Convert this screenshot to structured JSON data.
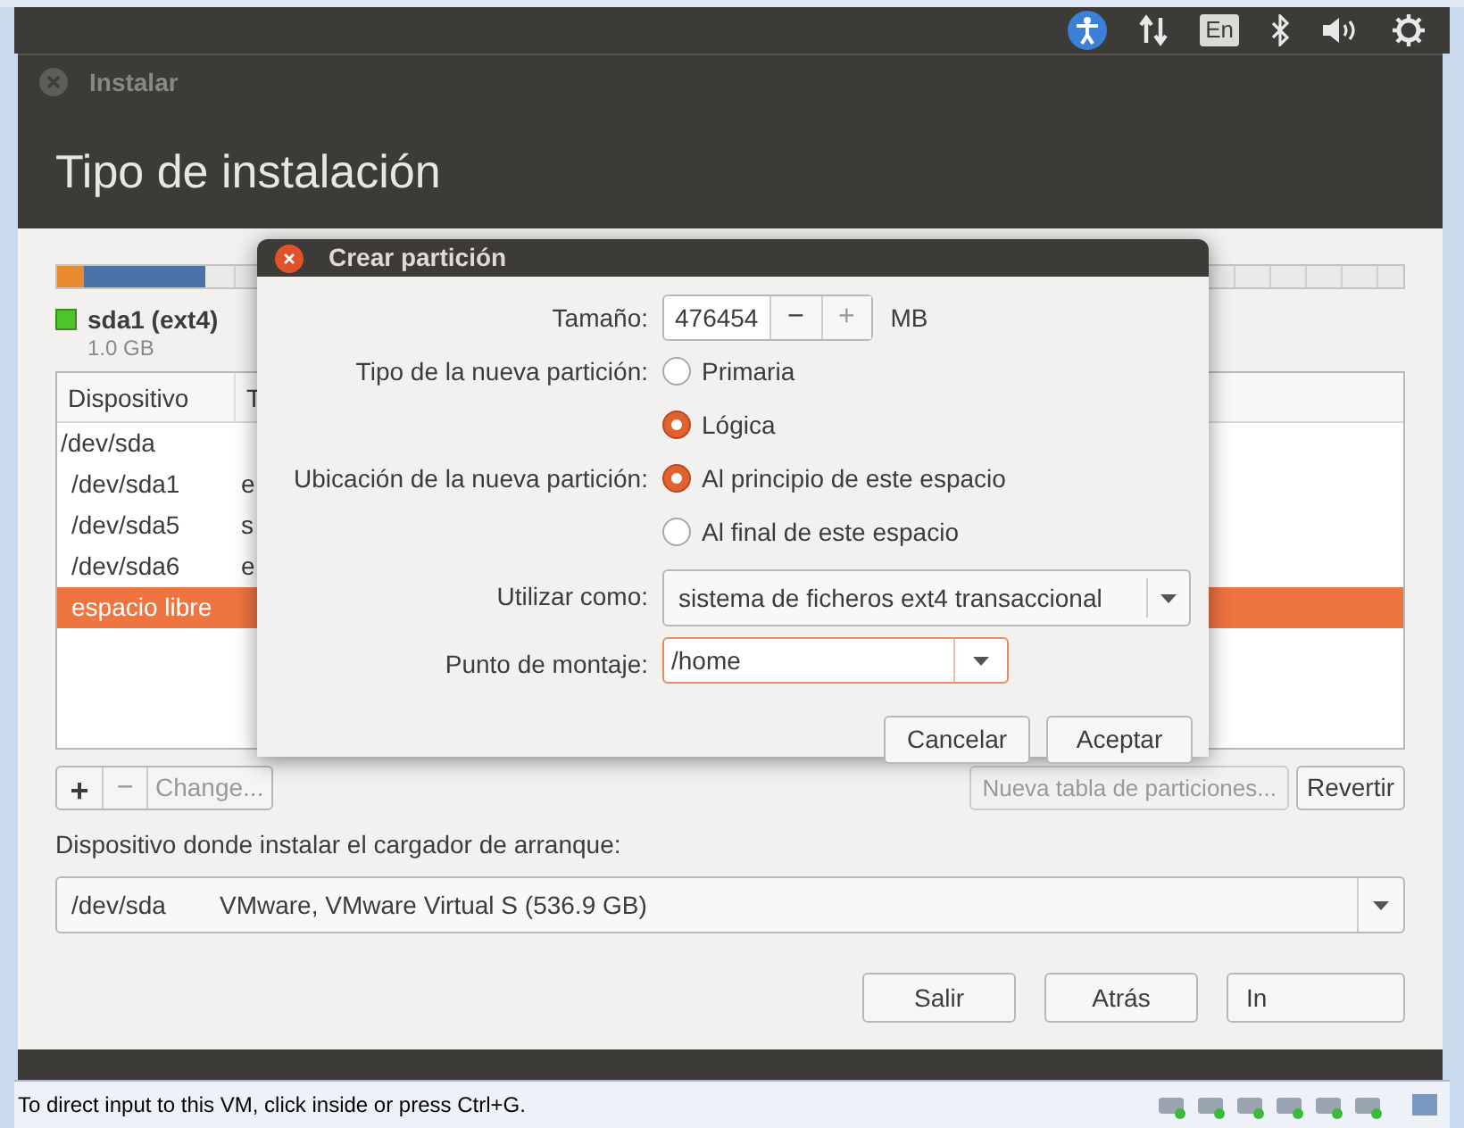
{
  "top_panel": {
    "language": "En"
  },
  "window": {
    "title": "Instalar",
    "heading": "Tipo de instalación"
  },
  "partition_bar": {
    "segments": [
      {
        "color": "#e88a2e",
        "level": 0.02
      },
      {
        "color": "#4a72a8",
        "level": 0.11
      }
    ]
  },
  "legend": {
    "label": "sda1 (ext4)",
    "size": "1.0 GB",
    "color": "#4ec62b"
  },
  "table": {
    "columns": [
      "Dispositivo",
      "T"
    ],
    "rows": [
      {
        "cells": [
          "/dev/sda",
          ""
        ],
        "selected": false,
        "children": [
          {
            "cells": [
              "/dev/sda1",
              "e"
            ],
            "selected": false
          },
          {
            "cells": [
              "/dev/sda5",
              "s"
            ],
            "selected": false
          },
          {
            "cells": [
              "/dev/sda6",
              "e"
            ],
            "selected": false
          },
          {
            "cells": [
              "espacio libre",
              ""
            ],
            "selected": true
          }
        ]
      }
    ]
  },
  "table_buttons": {
    "add": "+",
    "remove": "−",
    "change": "Change...",
    "new_table": "Nueva tabla de particiones...",
    "revert": "Revertir"
  },
  "bootloader": {
    "label": "Dispositivo donde instalar el cargador de arranque:",
    "device": "/dev/sda",
    "description": "VMware, VMware Virtual S (536.9 GB)"
  },
  "buttons": [
    "Salir",
    "Atrás",
    "In"
  ],
  "dialog": {
    "title": "Crear partición",
    "size_label": "Tamaño:",
    "size_value": "476454",
    "decrement": "−",
    "increment": "+",
    "unit": "MB",
    "type_label": "Tipo de la nueva partición:",
    "type_options": [
      {
        "label": "Primaria",
        "selected": false
      },
      {
        "label": "Lógica",
        "selected": true
      }
    ],
    "location_label": "Ubicación de la nueva partición:",
    "location_options": [
      {
        "label": "Al principio de este espacio",
        "selected": true
      },
      {
        "label": "Al final de este espacio",
        "selected": false
      }
    ],
    "use_label": "Utilizar como:",
    "use_value": "sistema de ficheros ext4 transaccional",
    "mount_label": "Punto de montaje:",
    "mount_value": "/home",
    "buttons": [
      "Cancelar",
      "Aceptar"
    ]
  },
  "status_bar": {
    "text": "To direct input to this VM, click inside or press Ctrl+G."
  }
}
